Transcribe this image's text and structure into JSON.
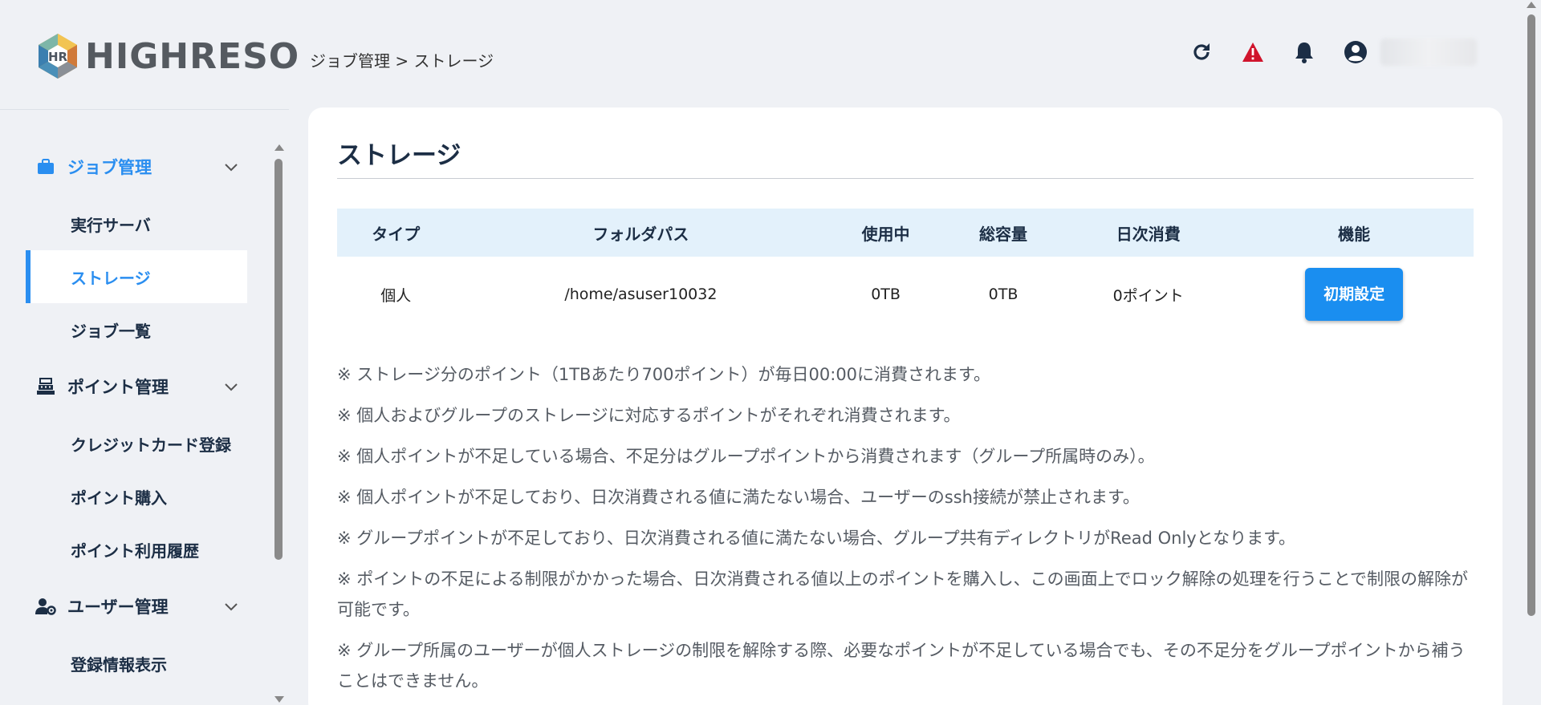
{
  "logo": {
    "text": "HIGHRESO"
  },
  "breadcrumb": "ジョブ管理 > ストレージ",
  "sidebar": {
    "groups": [
      {
        "label": "ジョブ管理",
        "icon": "briefcase-icon",
        "items": [
          "実行サーバ",
          "ストレージ",
          "ジョブ一覧"
        ]
      },
      {
        "label": "ポイント管理",
        "icon": "cash-register-icon",
        "items": [
          "クレジットカード登録",
          "ポイント購入",
          "ポイント利用履歴"
        ]
      },
      {
        "label": "ユーザー管理",
        "icon": "user-gear-icon",
        "items": [
          "登録情報表示"
        ]
      }
    ]
  },
  "card": {
    "title": "ストレージ",
    "table": {
      "headers": [
        "タイプ",
        "フォルダパス",
        "使用中",
        "総容量",
        "日次消費",
        "機能"
      ],
      "rows": [
        {
          "type": "個人",
          "path": "/home/asuser10032",
          "used": "0TB",
          "total": "0TB",
          "daily": "0ポイント",
          "action": "初期設定"
        }
      ]
    },
    "notes": [
      "※ ストレージ分のポイント（1TBあたり700ポイント）が毎日00:00に消費されます。",
      "※ 個人およびグループのストレージに対応するポイントがそれぞれ消費されます。",
      "※ 個人ポイントが不足している場合、不足分はグループポイントから消費されます（グループ所属時のみ）。",
      "※ 個人ポイントが不足しており、日次消費される値に満たない場合、ユーザーのssh接続が禁止されます。",
      "※ グループポイントが不足しており、日次消費される値に満たない場合、グループ共有ディレクトリがRead Onlyとなります。",
      "※ ポイントの不足による制限がかかった場合、日次消費される値以上のポイントを購入し、この画面上でロック解除の処理を行うことで制限の解除が可能です。",
      "※ グループ所属のユーザーが個人ストレージの制限を解除する際、必要なポイントが不足している場合でも、その不足分をグループポイントから補うことはできません。"
    ]
  },
  "colors": {
    "accent": "#2a8ef0",
    "alert": "#d0142c",
    "navy": "#1c2e45"
  }
}
